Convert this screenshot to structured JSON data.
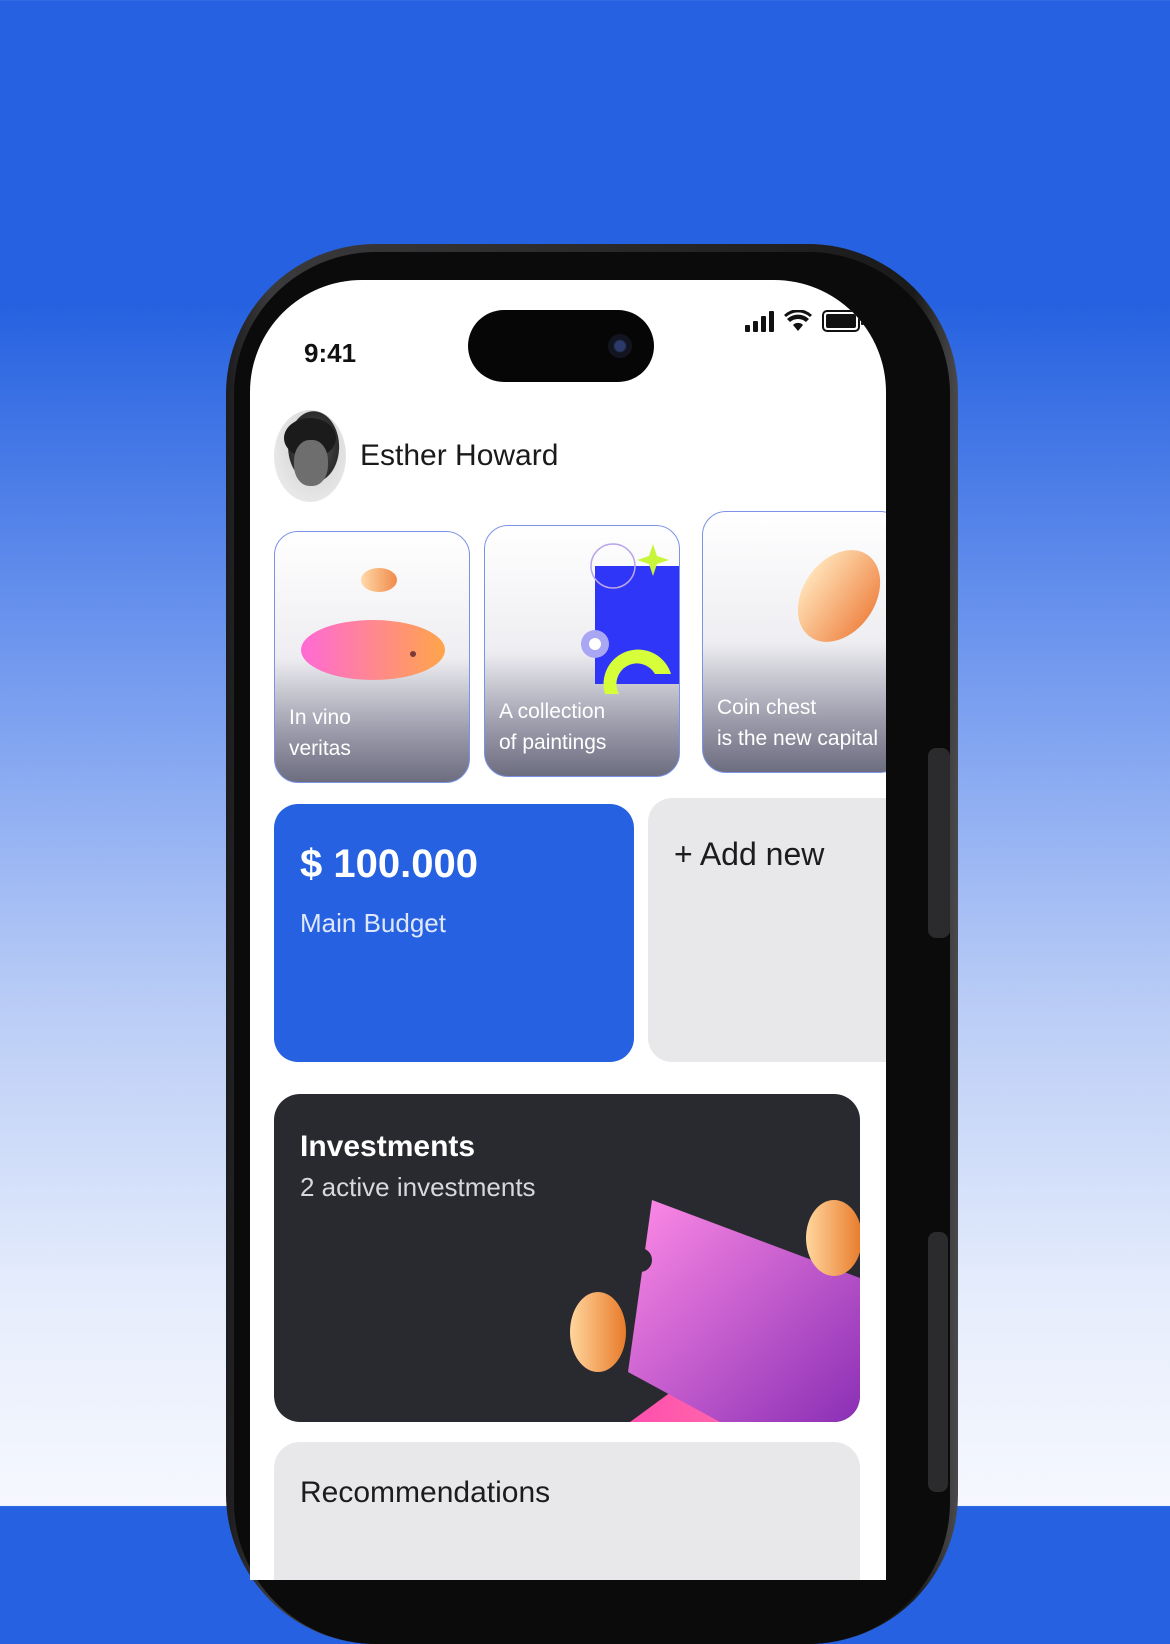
{
  "status_bar": {
    "time": "9:41"
  },
  "profile": {
    "name": "Esther Howard"
  },
  "stories": [
    {
      "title": "In vino\nveritas"
    },
    {
      "title": "A collection\nof paintings"
    },
    {
      "title": "Coin chest\nis the new capital"
    }
  ],
  "budget": {
    "amount": "$ 100.000",
    "label": "Main Budget"
  },
  "add_new": {
    "label": "+ Add new"
  },
  "investments": {
    "title": "Investments",
    "subtitle": "2 active investments"
  },
  "recommendations": {
    "title": "Recommendations"
  },
  "colors": {
    "accent": "#2561e0",
    "dark_card": "#292a2f",
    "light_card": "#e8e8ea"
  }
}
